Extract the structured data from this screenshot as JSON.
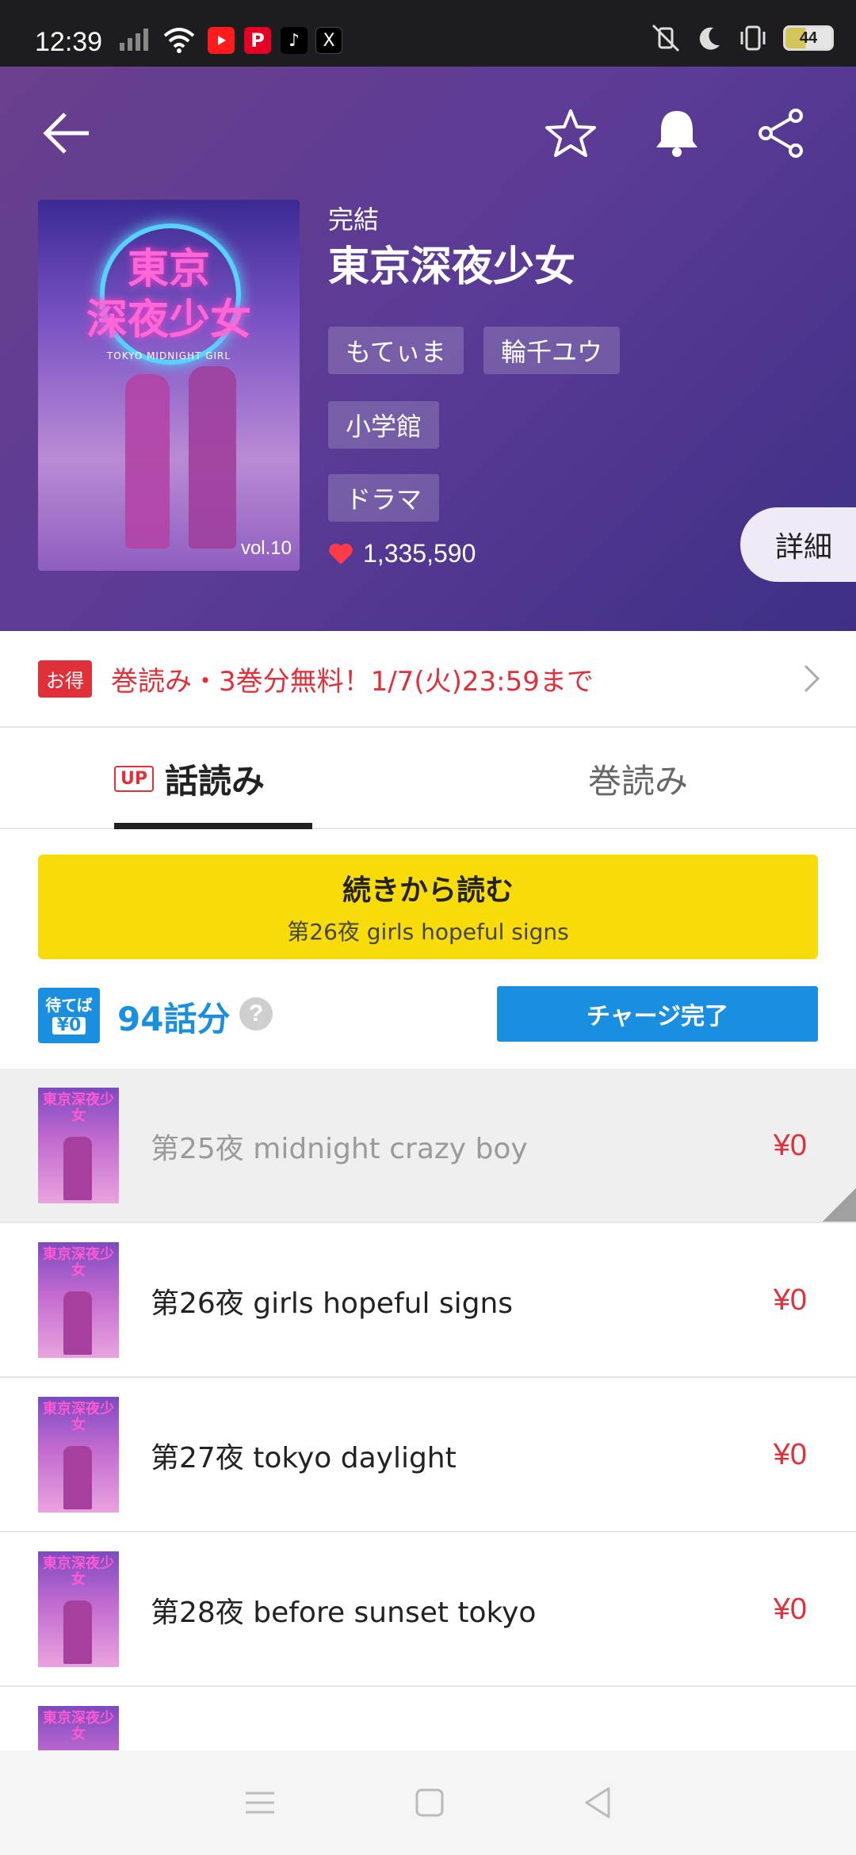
{
  "status_bar": {
    "time": "12:39",
    "battery": "44"
  },
  "header": {
    "status": "完結",
    "title": "東京深夜少女",
    "authors": [
      "もてぃま",
      "輪千ユウ"
    ],
    "publisher": "小学館",
    "genre": "ドラマ",
    "likes": "1,335,590",
    "details_label": "詳細",
    "cover": {
      "title_line1": "東京",
      "title_line2": "深夜少女",
      "subtitle": "TOKYO MIDNIGHT GIRL",
      "volume": "vol.10"
    }
  },
  "promo": {
    "badge": "お得",
    "text": "巻読み・3巻分無料！1/7(火)23:59まで"
  },
  "tabs": {
    "up_badge": "UP",
    "episode_tab": "話読み",
    "volume_tab": "巻読み"
  },
  "continue_button": {
    "label": "続きから読む",
    "episode": "第26夜 girls hopeful signs"
  },
  "wait_free": {
    "badge_top": "待てば",
    "badge_bottom": "¥0",
    "count": "94話分",
    "help": "?",
    "charge_label": "チャージ完了"
  },
  "episodes": [
    {
      "title": "第25夜 midnight crazy boy",
      "price": "¥0",
      "thumb_title": "東京深夜少女"
    },
    {
      "title": "第26夜 girls hopeful signs",
      "price": "¥0",
      "thumb_title": "東京深夜少女"
    },
    {
      "title": "第27夜 tokyo daylight",
      "price": "¥0",
      "thumb_title": "東京深夜少女"
    },
    {
      "title": "第28夜 before sunset tokyo",
      "price": "¥0",
      "thumb_title": "東京深夜少女"
    }
  ],
  "colors": {
    "header_bg": "#5a3b95",
    "accent_red": "#e0303a",
    "accent_blue": "#1a8fe0",
    "continue_yellow": "#f8dc0a"
  }
}
